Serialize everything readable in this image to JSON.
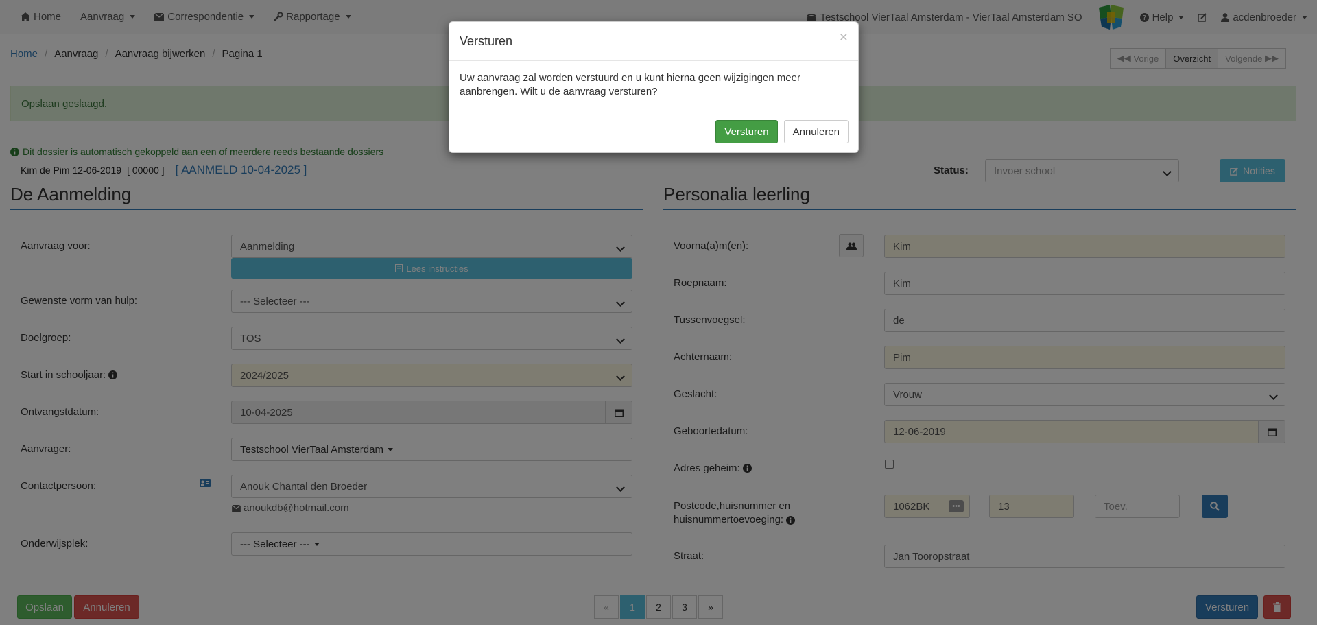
{
  "navbar": {
    "home": "Home",
    "aanvraag": "Aanvraag",
    "correspondentie": "Correspondentie",
    "rapportage": "Rapportage",
    "school": "Testschool VierTaal Amsterdam - VierTaal Amsterdam SO",
    "help": "Help",
    "user": "acdenbroeder"
  },
  "breadcrumb": [
    "Home",
    "Aanvraag",
    "Aanvraag bijwerken",
    "Pagina 1"
  ],
  "pager_top": {
    "vorige": "Vorige",
    "overzicht": "Overzicht",
    "volgende": "Volgende"
  },
  "alert": "Opslaan geslaagd.",
  "linked_note": "Dit dossier is automatisch gekoppeld aan een of meerdere reeds bestaande dossiers",
  "student": {
    "name": "Kim de Pim 12-06-2019",
    "number": "[ 00000 ]",
    "tag": "[ AANMELD 10-04-2025 ]"
  },
  "status": {
    "label": "Status:",
    "value": "Invoer school"
  },
  "notities": "Notities",
  "left": {
    "title": "De Aanmelding",
    "aanvraag_voor_label": "Aanvraag voor:",
    "aanvraag_voor_value": "Aanmelding",
    "lees_instructies": "Lees instructies",
    "vorm_label": "Gewenste vorm van hulp:",
    "vorm_value": "--- Selecteer ---",
    "doelgroep_label": "Doelgroep:",
    "doelgroep_value": "TOS",
    "schooljaar_label": "Start in schooljaar:",
    "schooljaar_value": "2024/2025",
    "ontvangst_label": "Ontvangstdatum:",
    "ontvangst_value": "10-04-2025",
    "aanvrager_label": "Aanvrager:",
    "aanvrager_value": "Testschool VierTaal Amsterdam",
    "contact_label": "Contactpersoon:",
    "contact_value": "Anouk Chantal den Broeder",
    "contact_email": "anoukdb@hotmail.com",
    "onderwijsplek_label": "Onderwijsplek:",
    "onderwijsplek_value": "--- Selecteer ---"
  },
  "right": {
    "title": "Personalia leerling",
    "voornamen_label": "Voorna(a)m(en):",
    "voornamen_value": "Kim",
    "roepnaam_label": "Roepnaam:",
    "roepnaam_value": "Kim",
    "tussenvoegsel_label": "Tussenvoegsel:",
    "tussenvoegsel_value": "de",
    "achternaam_label": "Achternaam:",
    "achternaam_value": "Pim",
    "geslacht_label": "Geslacht:",
    "geslacht_value": "Vrouw",
    "geboortedatum_label": "Geboortedatum:",
    "geboortedatum_value": "12-06-2019",
    "adres_geheim_label": "Adres geheim:",
    "postcode_label_1": "Postcode,huisnummer en",
    "postcode_label_2": "huisnummertoevoeging:",
    "postcode_value": "1062BK",
    "huisnummer_value": "13",
    "toevoeging_placeholder": "Toev.",
    "straat_label": "Straat:",
    "straat_value": "Jan Tooropstraat"
  },
  "footer": {
    "opslaan": "Opslaan",
    "annuleren": "Annuleren",
    "pages": [
      "«",
      "1",
      "2",
      "3",
      "»"
    ],
    "versturen": "Versturen"
  },
  "modal": {
    "title": "Versturen",
    "close": "×",
    "body": "Uw aanvraag zal worden verstuurd en u kunt hierna geen wijzigingen meer aanbrengen. Wilt u de aanvraag versturen?",
    "confirm": "Versturen",
    "cancel": "Annuleren"
  },
  "colors": {
    "primary": "#337ab7",
    "success": "#449d44",
    "danger": "#d9534f",
    "info": "#5bc0de",
    "warning_bg": "#fcf8e3"
  }
}
